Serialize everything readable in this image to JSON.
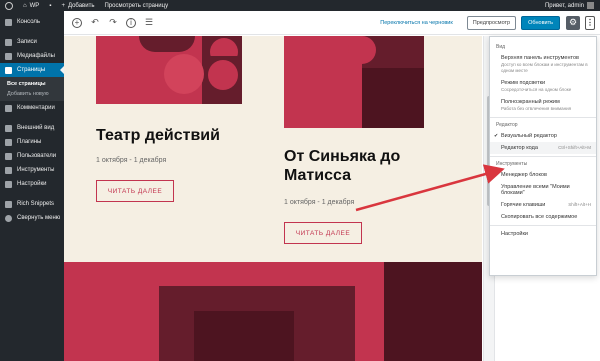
{
  "adminbar": {
    "site_name": "WP",
    "new_label": "Добавить",
    "view_label": "Просмотреть страницу",
    "greeting": "Привет, admin"
  },
  "sidebar": {
    "items": [
      {
        "label": "Консоль"
      },
      {
        "label": "Записи"
      },
      {
        "label": "Медиафайлы"
      },
      {
        "label": "Страницы"
      },
      {
        "label": "Комментарии"
      },
      {
        "label": "Внешний вид"
      },
      {
        "label": "Плагины"
      },
      {
        "label": "Пользователи"
      },
      {
        "label": "Инструменты"
      },
      {
        "label": "Настройки"
      },
      {
        "label": "Rich Snippets"
      },
      {
        "label": "Свернуть меню"
      }
    ],
    "submenu": [
      "Все страницы",
      "Добавить новую"
    ]
  },
  "toolbar": {
    "add_icon": "+",
    "undo_icon": "↶",
    "redo_icon": "↷",
    "info_icon": "i",
    "outline_icon": "☰",
    "switch_draft": "Переключиться на черновик",
    "preview": "Предпросмотр",
    "update": "Обновить",
    "settings_icon": "⚙",
    "more_icon": "⋮"
  },
  "canvas": {
    "cards": [
      {
        "title": "Театр действий",
        "date": "1 октября - 1 декабря",
        "button": "ЧИТАТЬ ДАЛЕЕ"
      },
      {
        "title_line1": "От Синьяка до",
        "title_line2": "Матисса",
        "date": "1 октября - 1 декабря",
        "button": "ЧИТАТЬ ДАЛЕЕ"
      }
    ]
  },
  "menu": {
    "view_label": "Вид",
    "top_toolbar": "Верхняя панель инструментов",
    "top_toolbar_desc": "Доступ ко всем блокам и инструментам в одном месте",
    "spotlight": "Режим подсветки",
    "spotlight_desc": "Сосредоточиться на одном блоке",
    "fullscreen": "Полноэкранный режим",
    "fullscreen_desc": "Работа без отвлечения внимания",
    "editor_label": "Редактор",
    "visual_editor": "Визуальный редактор",
    "code_editor": "Редактор кода",
    "code_shortcut": "Ctrl+Shift+Alt+M",
    "tools_label": "Инструменты",
    "block_manager": "Менеджер блоков",
    "reusable_blocks": "Управление всеми \"Моими блоками\"",
    "keyboard_shortcuts": "Горячие клавиши",
    "keyboard_shortcut_key": "Shift+Alt+H",
    "copy_all": "Скопировать все содержимое",
    "options": "Настройки"
  },
  "colors": {
    "accent_red": "#c2344f",
    "dark_red": "#651d2c",
    "maroon": "#4d1420",
    "cream": "#f5efe3",
    "admin_dark": "#23282d",
    "wp_blue": "#0073aa",
    "arrow": "#d9363e"
  }
}
